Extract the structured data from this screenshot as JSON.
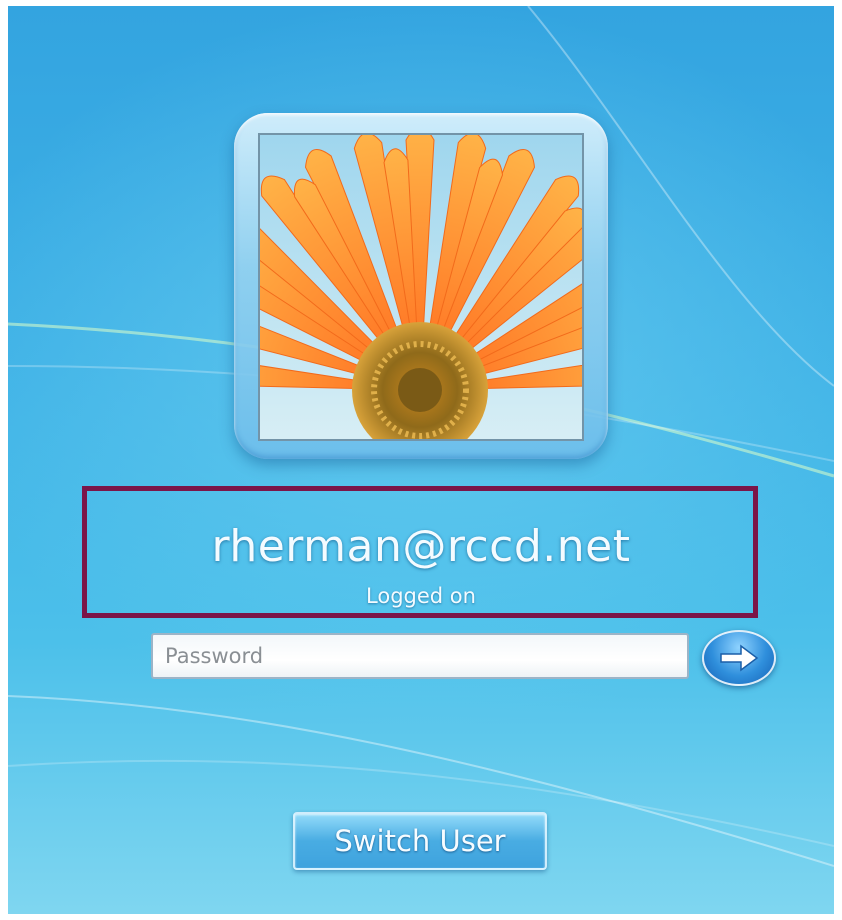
{
  "user": {
    "name": "rherman@rccd.net",
    "status": "Logged on"
  },
  "password": {
    "placeholder": "Password",
    "value": ""
  },
  "buttons": {
    "switch_user": "Switch User",
    "submit_icon": "arrow-right-icon"
  },
  "colors": {
    "highlight_border": "#7b1549",
    "background": "#3fb2e6",
    "flower": "#ff8a2a"
  }
}
